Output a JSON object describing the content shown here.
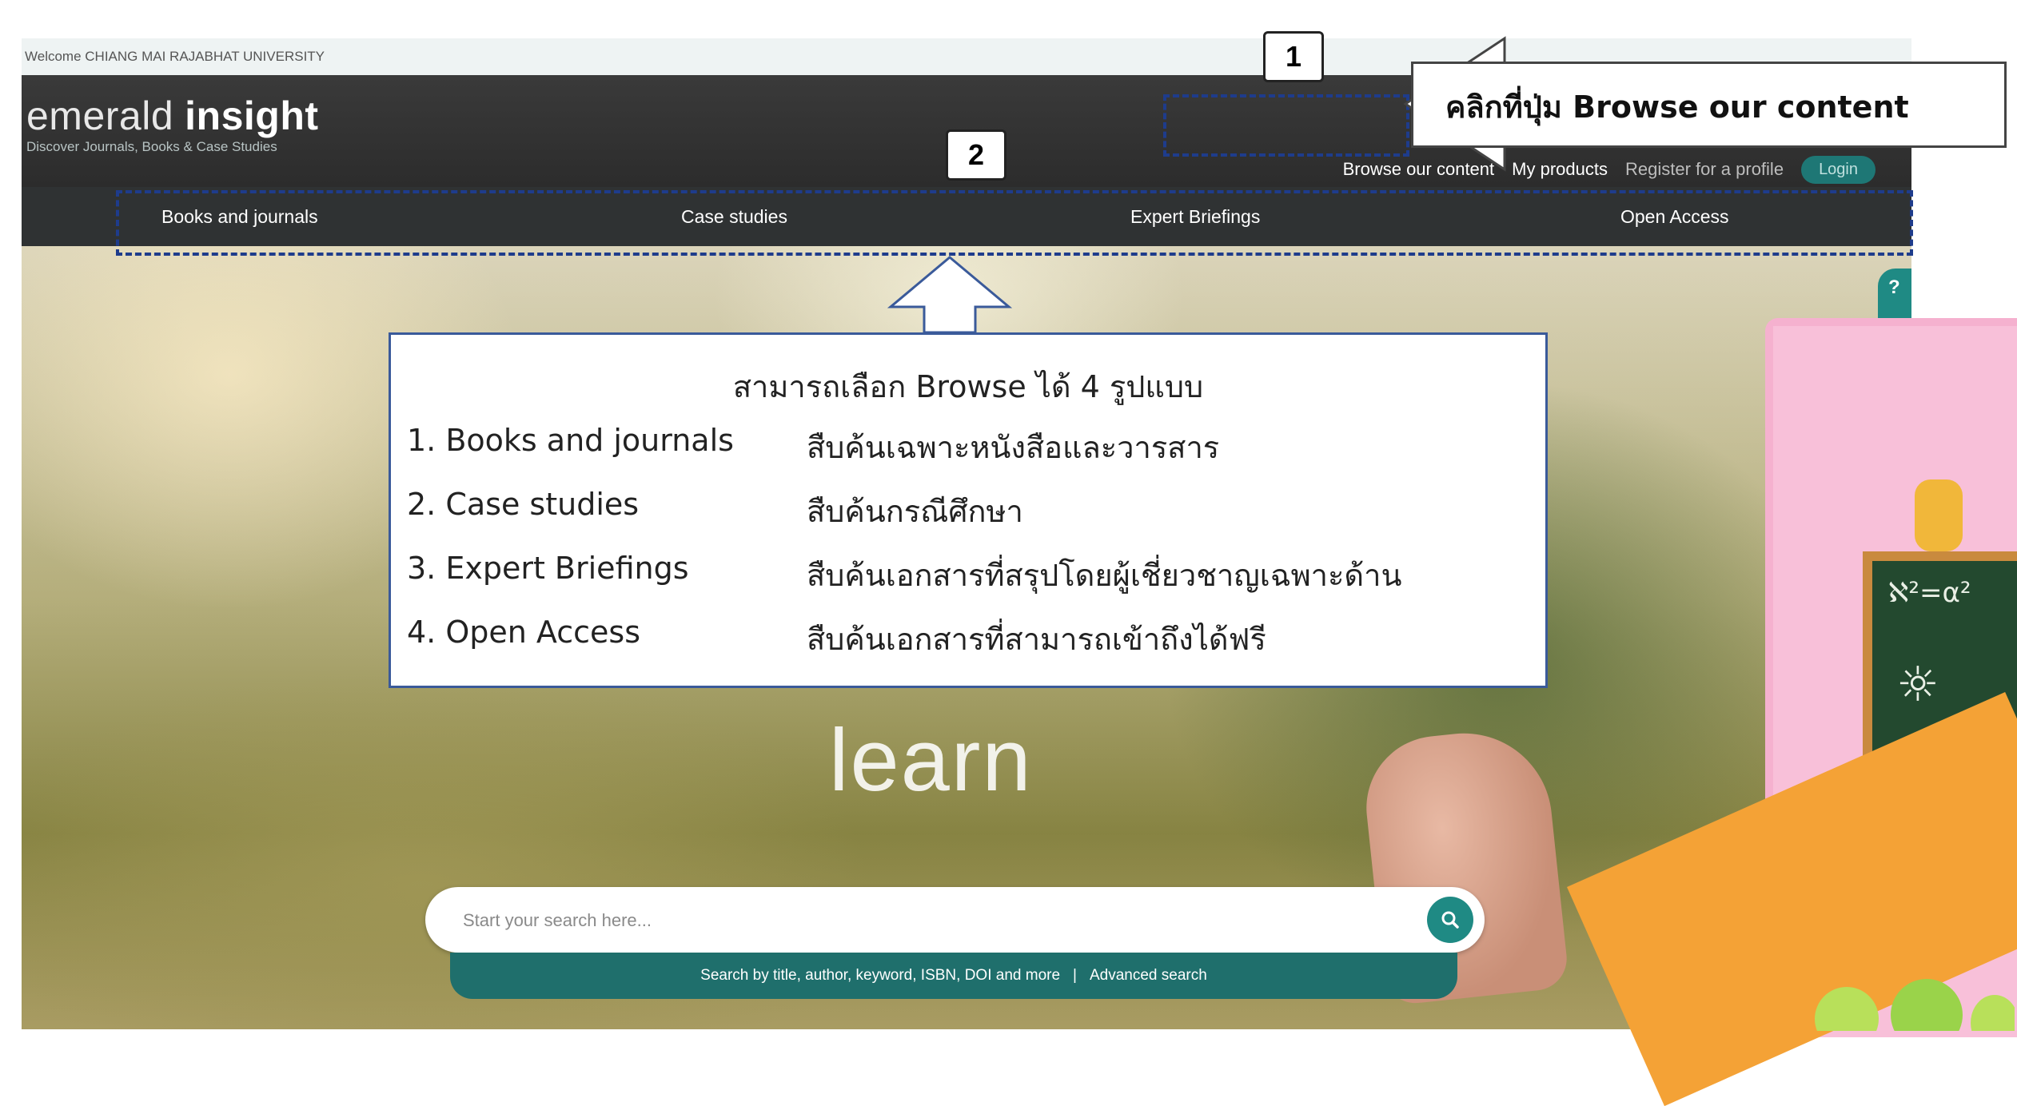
{
  "site": {
    "welcome_text": "Welcome CHIANG MAI RAJABHAT UNIVERSITY",
    "logo_word1": "emerald",
    "logo_word2": "insight",
    "logo_tagline": "Discover Journals, Books & Case Studies",
    "header_links": {
      "browse": "Browse our content",
      "my_products": "My products",
      "register": "Register for a profile",
      "login": "Login"
    },
    "nav": [
      "Books and journals",
      "Case studies",
      "Expert Briefings",
      "Open Access"
    ],
    "hero_word": "learn",
    "search": {
      "placeholder": "Start your search here...",
      "tagline": "Search by title, author, keyword, ISBN, DOI and more",
      "separator": "|",
      "advanced_link": "Advanced search"
    },
    "help_glyph": "?"
  },
  "annotations": {
    "badge1": "1",
    "badge2": "2",
    "callout": "คลิกที่ปุ่ม Browse our content",
    "info_title": "สามารถเลือก Browse ได้ 4 รูปแบบ",
    "items": [
      {
        "label": "1. Books and journals",
        "desc": "สืบค้นเฉพาะหนังสือและวารสาร"
      },
      {
        "label": "2. Case studies",
        "desc": "สืบค้นกรณีศึกษา"
      },
      {
        "label": "3. Expert Briefings",
        "desc": "สืบค้นเอกสารที่สรุปโดยผู้เชี่ยวชาญเฉพาะด้าน"
      },
      {
        "label": "4. Open Access",
        "desc": "สืบค้นเอกสารที่สามารถเข้าถึงได้ฟรี"
      }
    ]
  },
  "icons": {
    "search": "search-icon",
    "help": "help-icon",
    "arrow_left": "arrow-left-icon",
    "arrow_up": "arrow-up-icon"
  },
  "colors": {
    "header_bg": "#2c2c2c",
    "nav_bg": "#2f3233",
    "teal": "#1f8a84",
    "annotation_dash": "#1e3c8c"
  }
}
